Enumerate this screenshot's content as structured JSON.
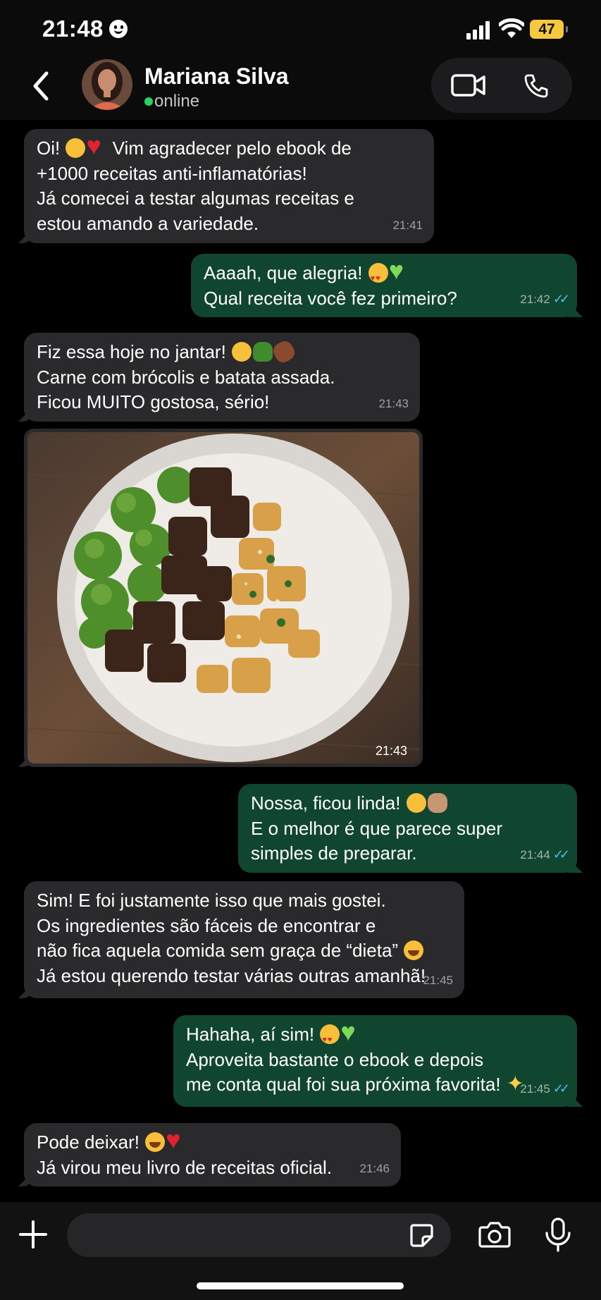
{
  "status": {
    "time": "21:48",
    "battery": "47"
  },
  "header": {
    "contact_name": "Mariana Silva",
    "presence": "online"
  },
  "messages": [
    {
      "dir": "in",
      "lines": [
        "Oi! 🥹❤️ Vim agradecer pelo ebook de",
        "+1000 receitas anti-inflamatórias!",
        "Já comecei a testar algumas receitas e",
        "estou amando a variedade."
      ],
      "time": "21:41"
    },
    {
      "dir": "out",
      "lines": [
        "Aaaah, que alegria! 😍💚",
        "Qual receita você fez primeiro?"
      ],
      "time": "21:42",
      "read": true
    },
    {
      "dir": "in",
      "lines": [
        "Fiz essa hoje no jantar! 🥰🥦🍠",
        "Carne com brócolis e batata assada.",
        "Ficou MUITO gostosa, sério!"
      ],
      "time": "21:43"
    },
    {
      "dir": "in",
      "type": "image",
      "image_desc": "food-photo",
      "time": "21:43"
    },
    {
      "dir": "out",
      "lines": [
        "Nossa, ficou linda! 🤤👏🏽",
        "E o melhor é que parece super",
        "simples de preparar."
      ],
      "time": "21:44",
      "read": true
    },
    {
      "dir": "in",
      "lines": [
        "Sim! E foi justamente isso que mais gostei.",
        "Os ingredientes são fáceis de encontrar e",
        "não fica aquela comida sem graça de “dieta” 😂",
        "Já estou querendo testar várias outras amanhã!"
      ],
      "time": "21:45"
    },
    {
      "dir": "out",
      "lines": [
        "Hahaha, aí sim! 😍💚",
        "Aproveita bastante o ebook e depois",
        "me conta qual foi sua próxima favorita! ✨"
      ],
      "time": "21:45",
      "read": true
    },
    {
      "dir": "in",
      "lines": [
        "Pode deixar! 😂❤️",
        "Já virou meu livro de receitas oficial."
      ],
      "time": "21:46"
    }
  ],
  "composer": {
    "placeholder": ""
  },
  "colors": {
    "incoming_bubble": "#2a2a2c",
    "outgoing_bubble": "#10452f",
    "read_ticks": "#53bdeb",
    "online_dot": "#25d366"
  },
  "icons": [
    "back-chevron-icon",
    "video-call-icon",
    "phone-icon",
    "plus-icon",
    "sticker-icon",
    "camera-icon",
    "microphone-icon"
  ]
}
